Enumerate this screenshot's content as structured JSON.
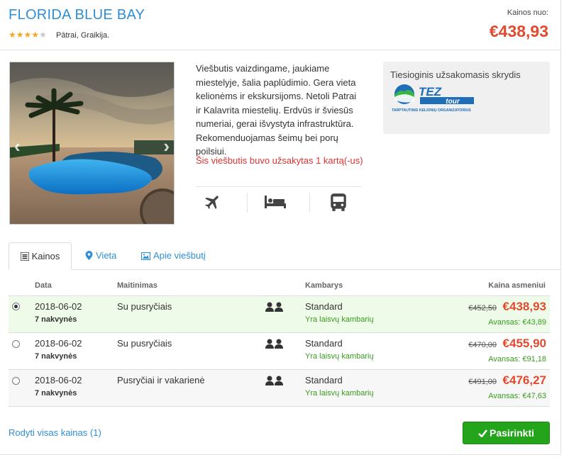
{
  "hotel": {
    "name": "FLORIDA BLUE BAY",
    "stars": 4,
    "max_stars": 5,
    "location": "Pātrai, Graikija."
  },
  "price_summary": {
    "label": "Kainos nuo:",
    "value": "€438,93"
  },
  "description": "Viešbutis vaizdingame, jaukiame miestelyje, šalia paplūdimio. Gera vieta kelionėms ir ekskursijoms. Netoli Patrai ir Kalavrita miestelių. Erdvūs ir šviesūs numeriai, gerai išvystyta infrastruktūra. Rekomenduojamas šeimų bei porų poilsiui.",
  "booked_notice": "Šis viešbutis buvo užsakytas 1 kartą(-us)",
  "features": [
    "airplane-icon",
    "bed-icon",
    "bus-icon"
  ],
  "flight": {
    "title": "Tiesioginis užsakomasis skrydis",
    "logo_text": "TEZ tour",
    "logo_subtext": "TARPTAUTINIS KELIONIŲ ORGANIZATORIUS"
  },
  "tabs": [
    {
      "label": "Kainos",
      "icon": "list-icon"
    },
    {
      "label": "Vieta",
      "icon": "map-pin-icon"
    },
    {
      "label": "Apie viešbutį",
      "icon": "image-icon"
    }
  ],
  "table": {
    "headers": {
      "date": "Data",
      "board": "Maitinimas",
      "room": "Kambarys",
      "price": "Kaina asmeniui"
    },
    "rows": [
      {
        "date": "2018-06-02",
        "nights": "7 nakvynės",
        "board": "Su pusryčiais",
        "room": "Standard",
        "availability": "Yra laisvų kambarių",
        "old_price": "€452,50",
        "price": "€438,93",
        "deposit": "Avansas: €43,89",
        "selected": true
      },
      {
        "date": "2018-06-02",
        "nights": "7 nakvynės",
        "board": "Su pusryčiais",
        "room": "Standard",
        "availability": "Yra laisvų kambarių",
        "old_price": "€470,00",
        "price": "€455,90",
        "deposit": "Avansas: €91,18",
        "selected": false
      },
      {
        "date": "2018-06-02",
        "nights": "7 nakvynės",
        "board": "Pusryčiai ir vakarienė",
        "room": "Standard",
        "availability": "Yra laisvų kambarių",
        "old_price": "€491,00",
        "price": "€476,27",
        "deposit": "Avansas: €47,63",
        "selected": false
      }
    ]
  },
  "footer": {
    "show_all": "Rodyti visas kainas (1)",
    "select_button": "Pasirinkti"
  },
  "colors": {
    "title_blue": "#2e8fd6",
    "price_red": "#e04a2f",
    "available_green": "#3a9a1f",
    "button_green": "#23a41b",
    "selected_row_bg": "#eefbe9"
  }
}
